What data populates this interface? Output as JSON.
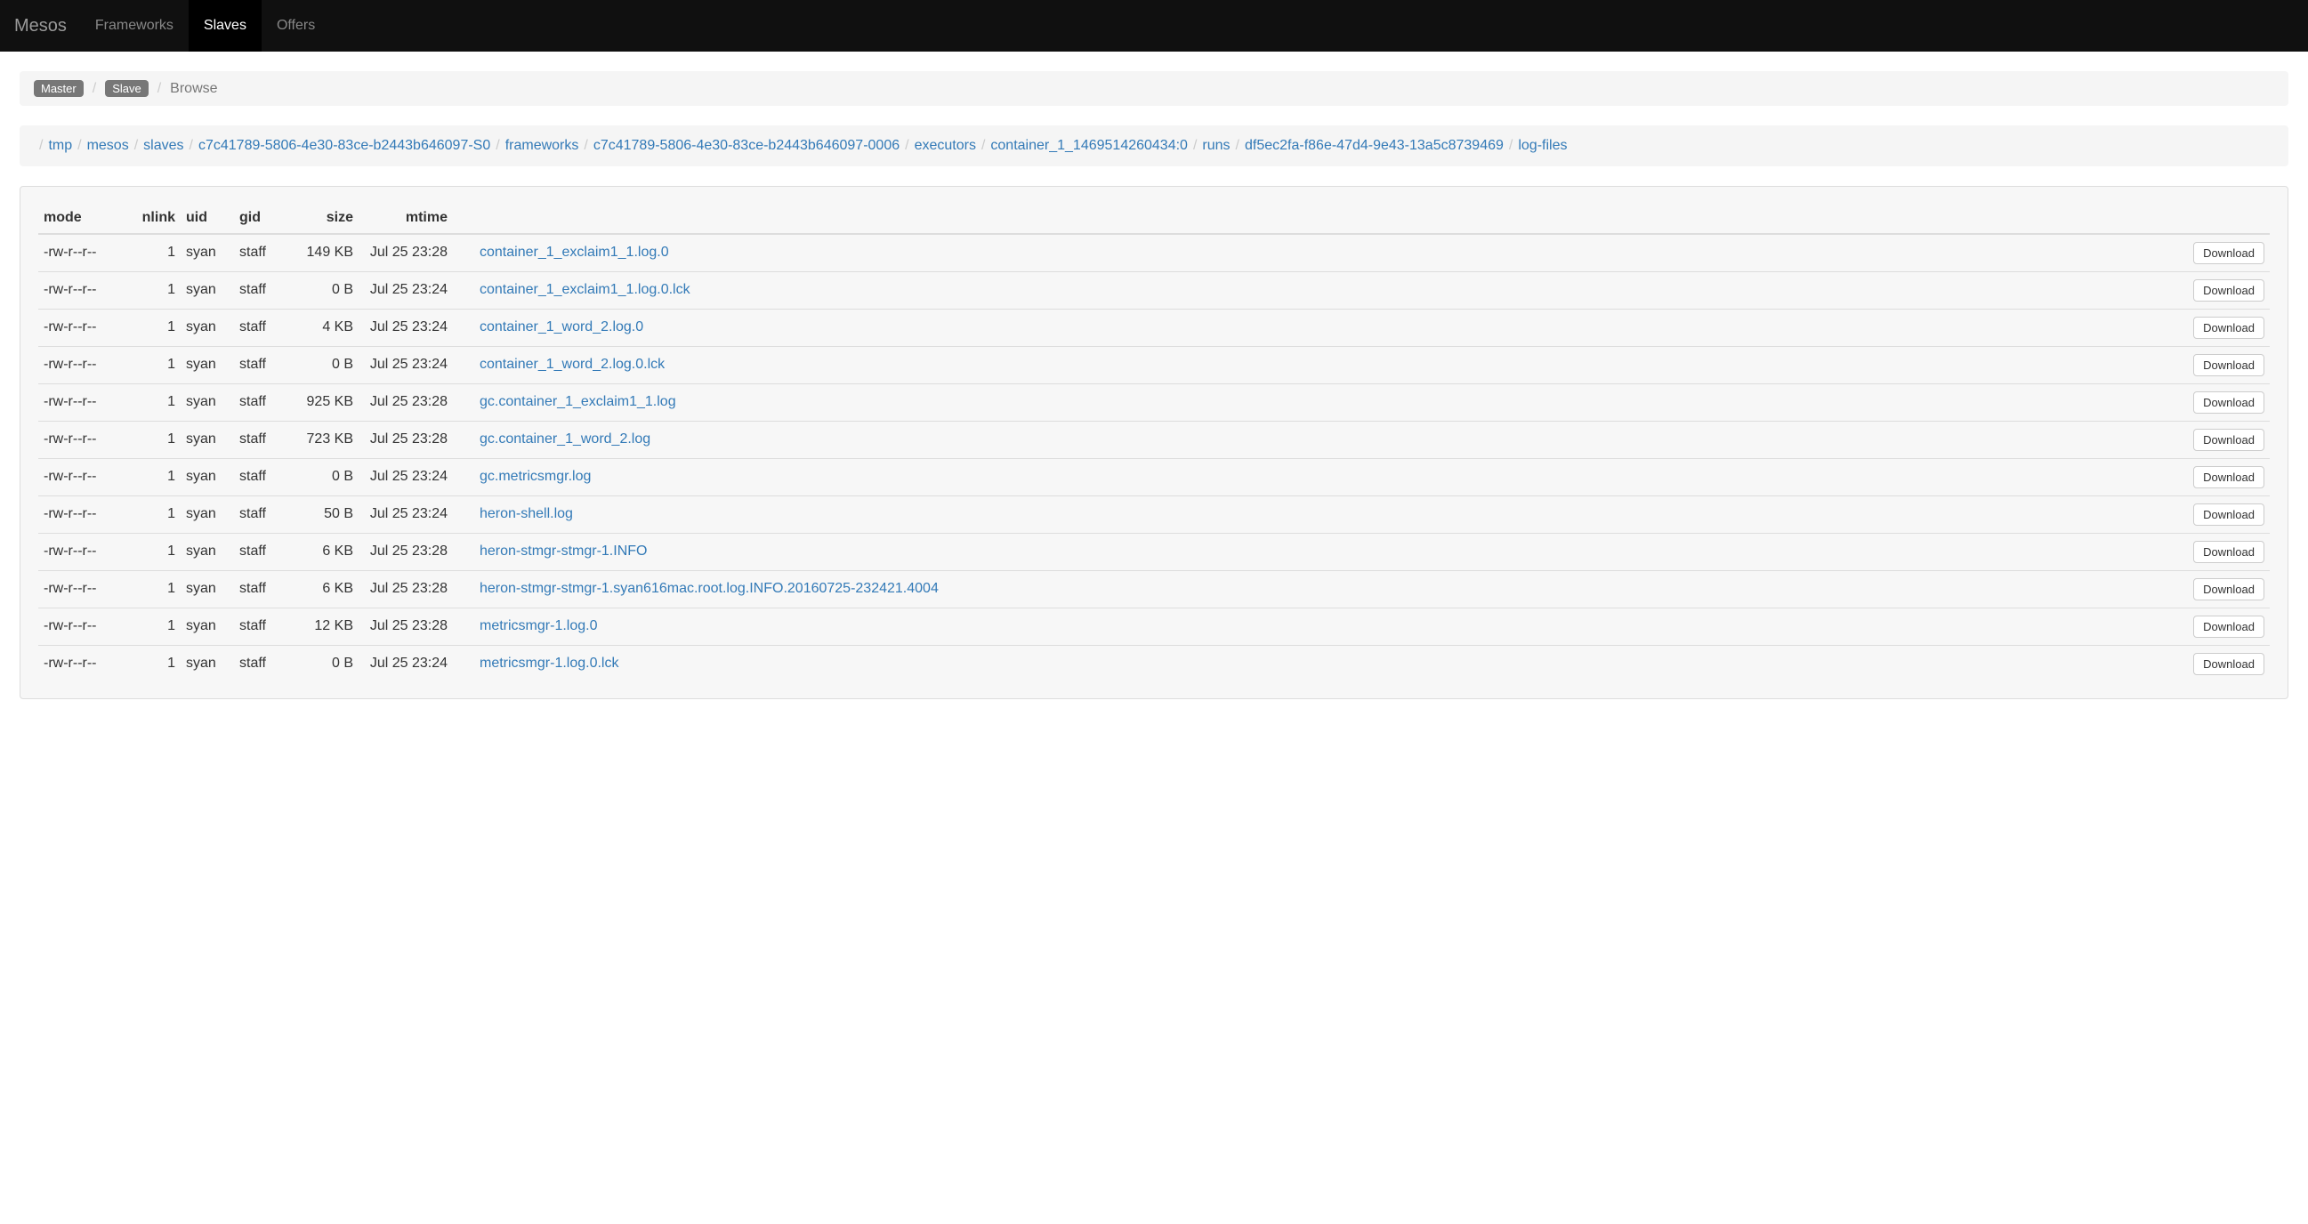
{
  "nav": {
    "brand": "Mesos",
    "items": [
      {
        "label": "Frameworks",
        "active": false
      },
      {
        "label": "Slaves",
        "active": true
      },
      {
        "label": "Offers",
        "active": false
      }
    ]
  },
  "breadcrumbTop": {
    "master": "Master",
    "slave": "Slave",
    "current": "Browse"
  },
  "pathCrumbs": [
    "tmp",
    "mesos",
    "slaves",
    "c7c41789-5806-4e30-83ce-b2443b646097-S0",
    "frameworks",
    "c7c41789-5806-4e30-83ce-b2443b646097-0006",
    "executors",
    "container_1_1469514260434:0",
    "runs",
    "df5ec2fa-f86e-47d4-9e43-13a5c8739469",
    "log-files"
  ],
  "table": {
    "headers": {
      "mode": "mode",
      "nlink": "nlink",
      "uid": "uid",
      "gid": "gid",
      "size": "size",
      "mtime": "mtime"
    },
    "downloadLabel": "Download",
    "rows": [
      {
        "mode": "-rw-r--r--",
        "nlink": "1",
        "uid": "syan",
        "gid": "staff",
        "size": "149 KB",
        "mtime": "Jul 25 23:28",
        "name": "container_1_exclaim1_1.log.0"
      },
      {
        "mode": "-rw-r--r--",
        "nlink": "1",
        "uid": "syan",
        "gid": "staff",
        "size": "0 B",
        "mtime": "Jul 25 23:24",
        "name": "container_1_exclaim1_1.log.0.lck"
      },
      {
        "mode": "-rw-r--r--",
        "nlink": "1",
        "uid": "syan",
        "gid": "staff",
        "size": "4 KB",
        "mtime": "Jul 25 23:24",
        "name": "container_1_word_2.log.0"
      },
      {
        "mode": "-rw-r--r--",
        "nlink": "1",
        "uid": "syan",
        "gid": "staff",
        "size": "0 B",
        "mtime": "Jul 25 23:24",
        "name": "container_1_word_2.log.0.lck"
      },
      {
        "mode": "-rw-r--r--",
        "nlink": "1",
        "uid": "syan",
        "gid": "staff",
        "size": "925 KB",
        "mtime": "Jul 25 23:28",
        "name": "gc.container_1_exclaim1_1.log"
      },
      {
        "mode": "-rw-r--r--",
        "nlink": "1",
        "uid": "syan",
        "gid": "staff",
        "size": "723 KB",
        "mtime": "Jul 25 23:28",
        "name": "gc.container_1_word_2.log"
      },
      {
        "mode": "-rw-r--r--",
        "nlink": "1",
        "uid": "syan",
        "gid": "staff",
        "size": "0 B",
        "mtime": "Jul 25 23:24",
        "name": "gc.metricsmgr.log"
      },
      {
        "mode": "-rw-r--r--",
        "nlink": "1",
        "uid": "syan",
        "gid": "staff",
        "size": "50 B",
        "mtime": "Jul 25 23:24",
        "name": "heron-shell.log"
      },
      {
        "mode": "-rw-r--r--",
        "nlink": "1",
        "uid": "syan",
        "gid": "staff",
        "size": "6 KB",
        "mtime": "Jul 25 23:28",
        "name": "heron-stmgr-stmgr-1.INFO"
      },
      {
        "mode": "-rw-r--r--",
        "nlink": "1",
        "uid": "syan",
        "gid": "staff",
        "size": "6 KB",
        "mtime": "Jul 25 23:28",
        "name": "heron-stmgr-stmgr-1.syan616mac.root.log.INFO.20160725-232421.4004"
      },
      {
        "mode": "-rw-r--r--",
        "nlink": "1",
        "uid": "syan",
        "gid": "staff",
        "size": "12 KB",
        "mtime": "Jul 25 23:28",
        "name": "metricsmgr-1.log.0"
      },
      {
        "mode": "-rw-r--r--",
        "nlink": "1",
        "uid": "syan",
        "gid": "staff",
        "size": "0 B",
        "mtime": "Jul 25 23:24",
        "name": "metricsmgr-1.log.0.lck"
      }
    ]
  }
}
